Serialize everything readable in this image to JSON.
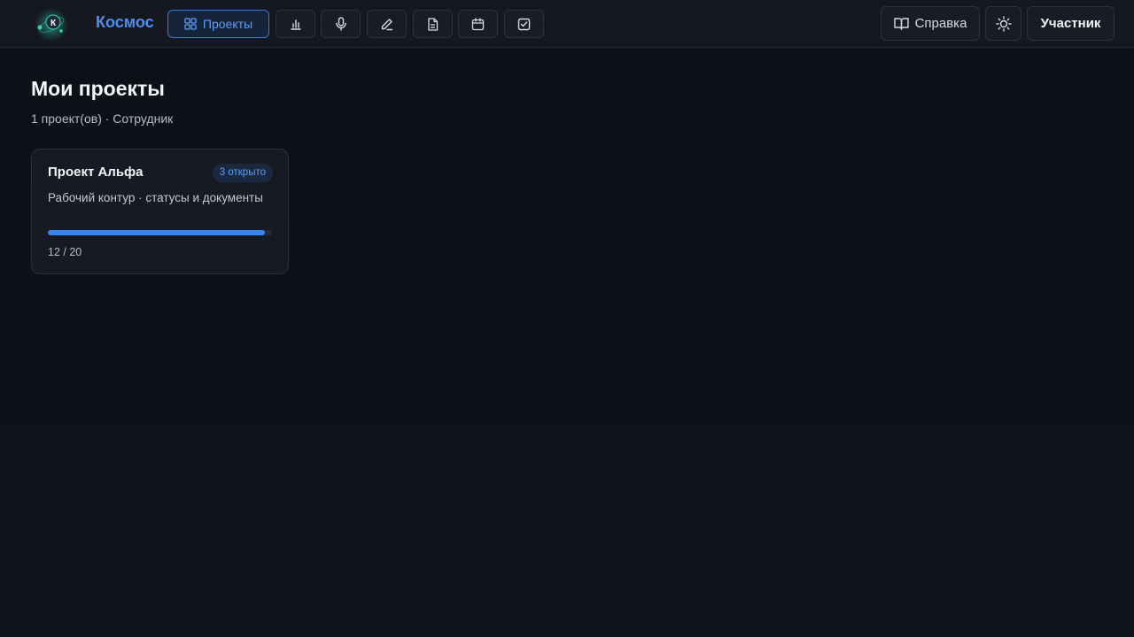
{
  "header": {
    "brand": "Космос",
    "logo_letter": "К",
    "nav": [
      {
        "label": "Проекты",
        "icon": "grid-icon",
        "active": true
      },
      {
        "icon": "bar-chart-icon"
      },
      {
        "icon": "microphone-icon"
      },
      {
        "icon": "pencil-icon"
      },
      {
        "icon": "document-icon"
      },
      {
        "icon": "calendar-icon"
      },
      {
        "icon": "checkbox-icon"
      }
    ],
    "help_label": "Справка",
    "theme_icon": "sun-icon",
    "user_label": "Участник"
  },
  "main": {
    "title": "Мои проекты",
    "subtitle": "1 проект(ов) · Сотрудник",
    "projects": [
      {
        "name": "Проект Альфа",
        "badge": "3 открыто",
        "description": "Рабочий контур · статусы и документы",
        "progress_text": "12 / 20",
        "progress_percent": 97
      }
    ]
  },
  "colors": {
    "accent": "#4c8fef",
    "active_border": "#3a78d6",
    "progress": "#3a86f0",
    "logo_glow": "#2fd4b0"
  }
}
